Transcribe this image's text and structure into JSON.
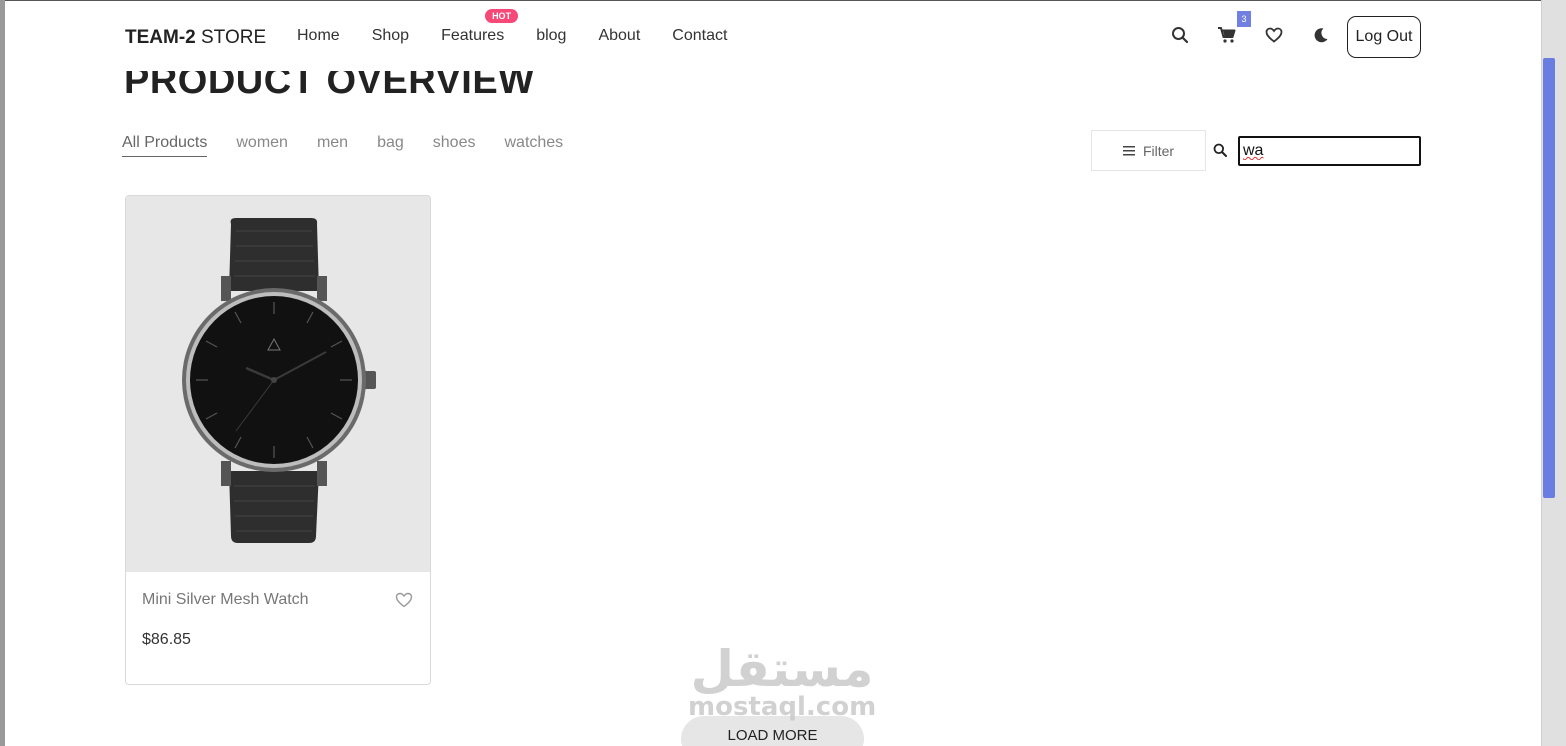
{
  "header": {
    "brand_bold": "TEAM-2",
    "brand_rest": " STORE",
    "nav": [
      "Home",
      "Shop",
      "Features",
      "blog",
      "About",
      "Contact"
    ],
    "hot_badge": "HOT",
    "cart_count": "3",
    "logout_label": "Log Out",
    "icons": [
      "search-icon",
      "cart-icon",
      "heart-icon",
      "moon-icon"
    ]
  },
  "page": {
    "title": "PRODUCT OVERVIEW",
    "categories": [
      "All Products",
      "women",
      "men",
      "bag",
      "shoes",
      "watches"
    ],
    "filter_label": "Filter",
    "search_value": "wa"
  },
  "products": [
    {
      "name": "Mini Silver Mesh Watch",
      "price": "$86.85"
    }
  ],
  "load_more_label": "LOAD MORE",
  "watermark": {
    "arabic": "مستقل",
    "latin": "mostaql.com"
  },
  "colors": {
    "accent": "#717fe0",
    "hot": "#f74877",
    "scroll_thumb": "#6a7de0"
  }
}
